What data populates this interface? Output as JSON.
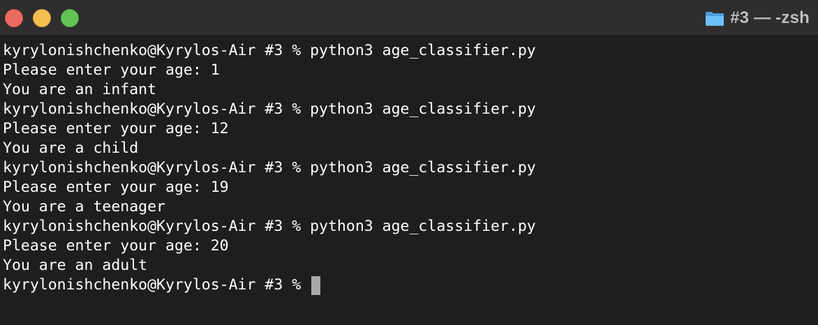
{
  "window": {
    "title": "#3 — -zsh",
    "folder_icon": "folder-icon",
    "accent_folder_color": "#5ab4f0",
    "buttons": {
      "close_color": "#ec6a5e",
      "minimize_color": "#f4bf4f",
      "zoom_color": "#61c554"
    }
  },
  "terminal": {
    "lines": [
      "kyrylonishchenko@Kyrylos-Air #3 % python3 age_classifier.py",
      "Please enter your age: 1",
      "You are an infant",
      "kyrylonishchenko@Kyrylos-Air #3 % python3 age_classifier.py",
      "Please enter your age: 12",
      "You are a child",
      "kyrylonishchenko@Kyrylos-Air #3 % python3 age_classifier.py",
      "Please enter your age: 19",
      "You are a teenager",
      "kyrylonishchenko@Kyrylos-Air #3 % python3 age_classifier.py",
      "Please enter your age: 20",
      "You are an adult"
    ],
    "current_prompt": "kyrylonishchenko@Kyrylos-Air #3 % "
  }
}
